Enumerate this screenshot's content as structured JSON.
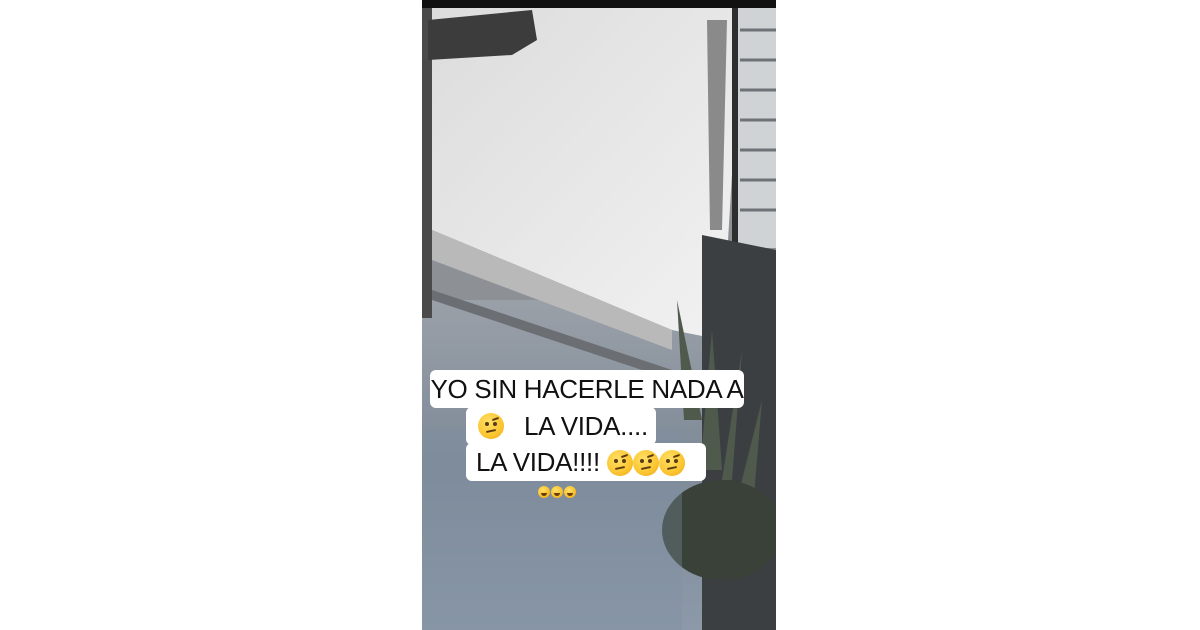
{
  "caption": {
    "line1": "YO SIN HACERLE NADA A",
    "line2": "LA VIDA....",
    "line3": "LA VIDA!!!!",
    "line2_emoji": "raised-eyebrow-emoji",
    "line3_emojis": [
      "raised-eyebrow-emoji",
      "raised-eyebrow-emoji",
      "raised-eyebrow-emoji"
    ],
    "trailing_emojis": [
      "laughing-crying-emoji",
      "laughing-crying-emoji",
      "laughing-crying-emoji"
    ]
  },
  "colors": {
    "caption_background": "#ffffff",
    "caption_text": "#111111",
    "page_background": "#ffffff"
  }
}
